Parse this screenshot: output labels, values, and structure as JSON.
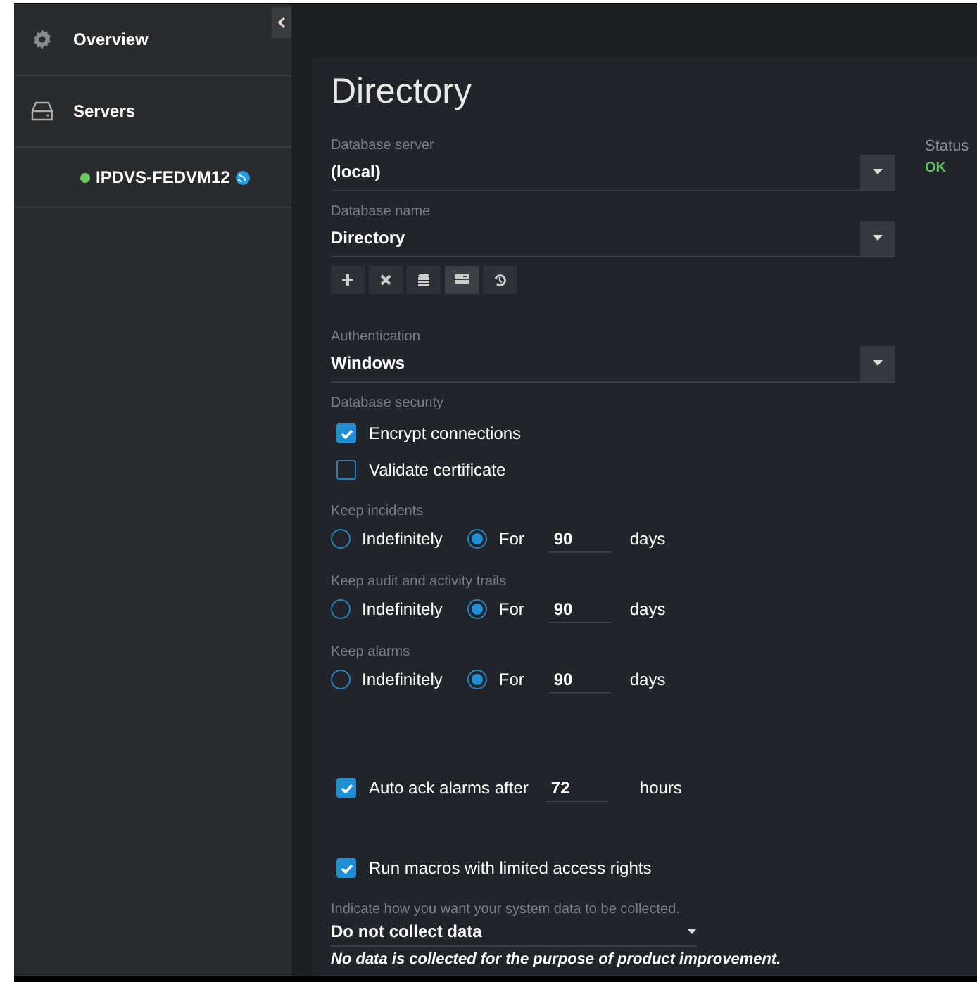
{
  "sidebar": {
    "items": [
      {
        "kind": "nav",
        "label": "Overview"
      },
      {
        "kind": "nav",
        "label": "Servers"
      },
      {
        "kind": "server",
        "label": "IPDVS-FEDVM12",
        "color": "#6ccb5f"
      }
    ]
  },
  "title": "Directory",
  "form": [
    {
      "kind": "select",
      "label": "Database server",
      "value": "(local)",
      "status_label": "Status",
      "status_value": "OK"
    },
    {
      "kind": "select",
      "label": "Database name",
      "value": "Directory"
    },
    {
      "kind": "toolbar",
      "buttons": [
        {
          "selected": false
        },
        {
          "selected": false
        },
        {
          "selected": false
        },
        {
          "selected": true
        },
        {
          "selected": false
        }
      ]
    },
    {
      "kind": "select",
      "label": "Authentication",
      "value": "Windows"
    },
    {
      "kind": "checks",
      "label": "Database security",
      "items": [
        {
          "label": "Encrypt connections",
          "checked": true
        },
        {
          "label": "Validate certificate",
          "checked": false
        }
      ]
    },
    {
      "kind": "retention",
      "label": "Keep incidents",
      "options": [
        {
          "label": "Indefinitely",
          "selected": false
        },
        {
          "label": "For",
          "selected": true
        }
      ],
      "value": "90",
      "unit": "days"
    },
    {
      "kind": "retention",
      "label": "Keep audit and activity trails",
      "options": [
        {
          "label": "Indefinitely",
          "selected": false
        },
        {
          "label": "For",
          "selected": true
        }
      ],
      "value": "90",
      "unit": "days"
    },
    {
      "kind": "retention",
      "label": "Keep alarms",
      "options": [
        {
          "label": "Indefinitely",
          "selected": false
        },
        {
          "label": "For",
          "selected": true
        }
      ],
      "value": "90",
      "unit": "days"
    },
    {
      "kind": "check_input",
      "label": "Auto ack alarms after",
      "checked": true,
      "value": "72",
      "unit": "hours"
    },
    {
      "kind": "check",
      "label": "Run macros with limited access rights",
      "checked": true
    },
    {
      "kind": "dropdown",
      "label": "Indicate how you want your system data to be collected.",
      "value": "Do not collect data",
      "note": "No data is collected for the purpose of product improvement."
    }
  ]
}
